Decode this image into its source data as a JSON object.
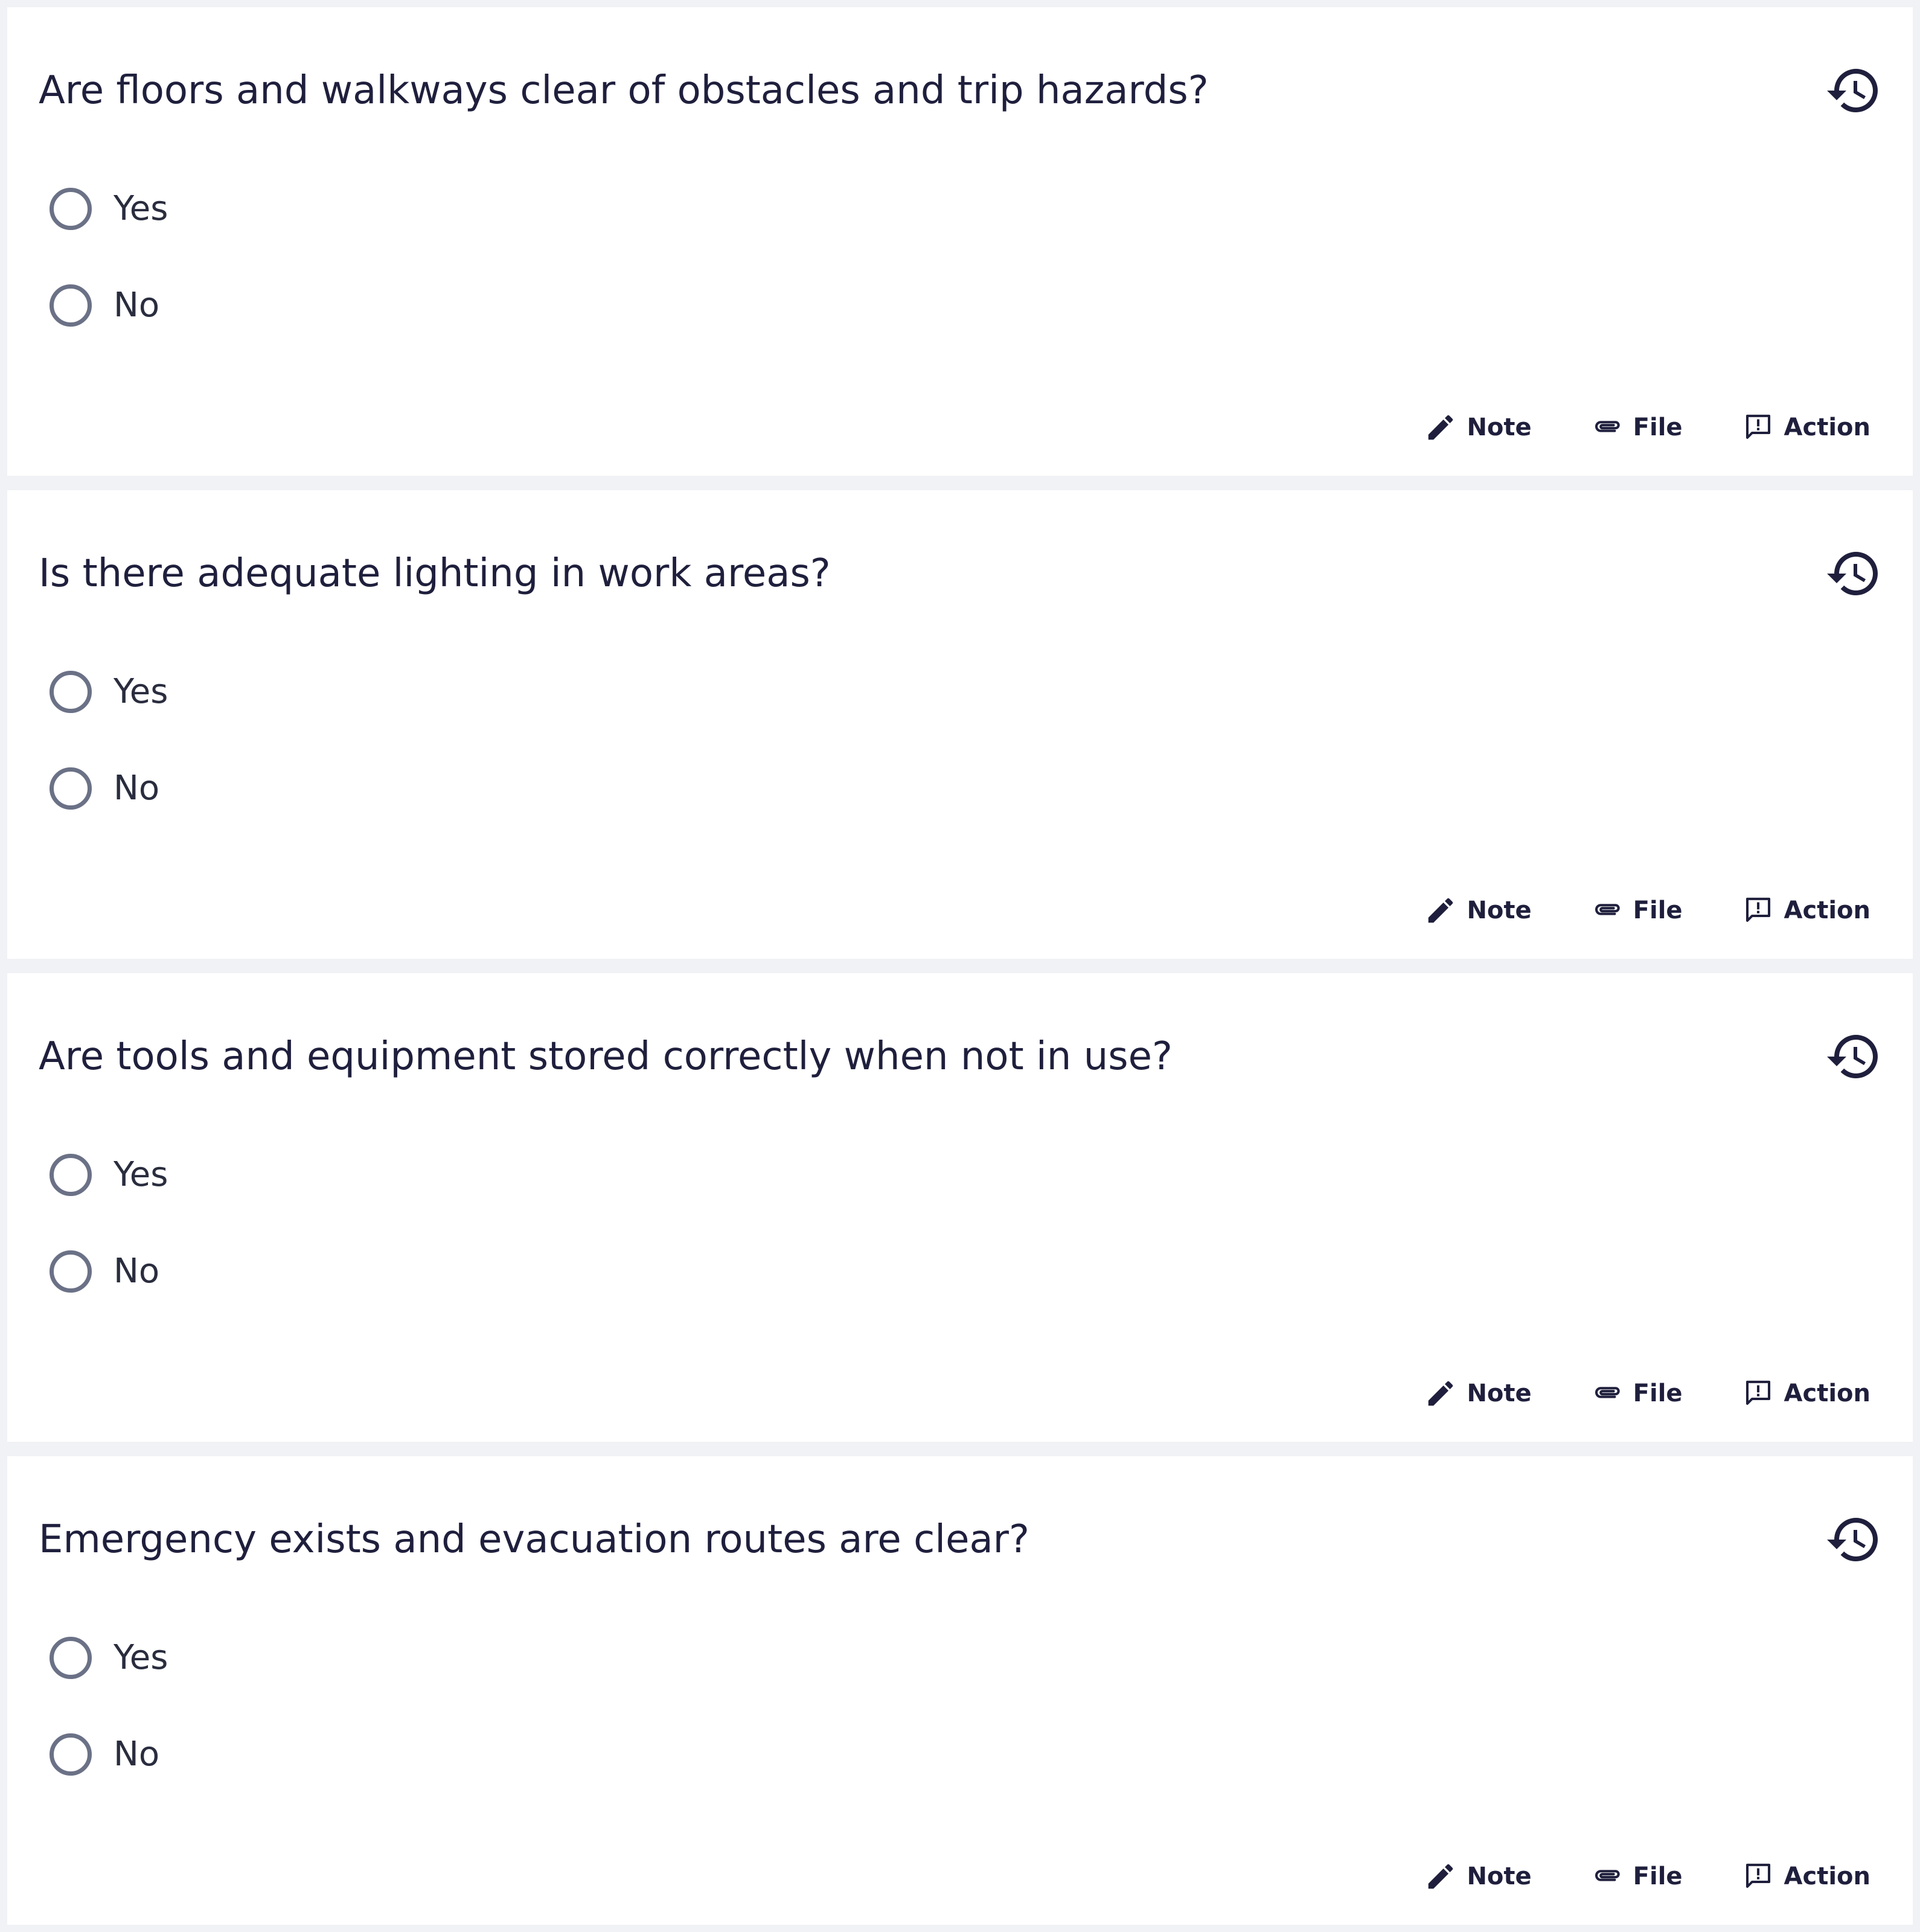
{
  "questions": [
    {
      "text": "Are floors and walkways clear of obstacles and trip hazards?",
      "options": [
        {
          "label": "Yes"
        },
        {
          "label": "No"
        }
      ],
      "actions": {
        "note": "Note",
        "file": "File",
        "action": "Action"
      }
    },
    {
      "text": "Is there adequate lighting in work areas?",
      "options": [
        {
          "label": "Yes"
        },
        {
          "label": "No"
        }
      ],
      "actions": {
        "note": "Note",
        "file": "File",
        "action": "Action"
      }
    },
    {
      "text": "Are tools and equipment stored correctly when not in use?",
      "options": [
        {
          "label": "Yes"
        },
        {
          "label": "No"
        }
      ],
      "actions": {
        "note": "Note",
        "file": "File",
        "action": "Action"
      }
    },
    {
      "text": "Emergency exists and evacuation routes are clear?",
      "options": [
        {
          "label": "Yes"
        },
        {
          "label": "No"
        }
      ],
      "actions": {
        "note": "Note",
        "file": "File",
        "action": "Action"
      }
    }
  ],
  "icons": {
    "history": "history-icon",
    "note": "pencil-icon",
    "file": "paperclip-icon",
    "action": "feedback-icon"
  },
  "colors": {
    "page_background": "#f1f2f5",
    "card_background": "#ffffff",
    "text": "#1f1f3d",
    "radio_border": "#6b7186"
  }
}
